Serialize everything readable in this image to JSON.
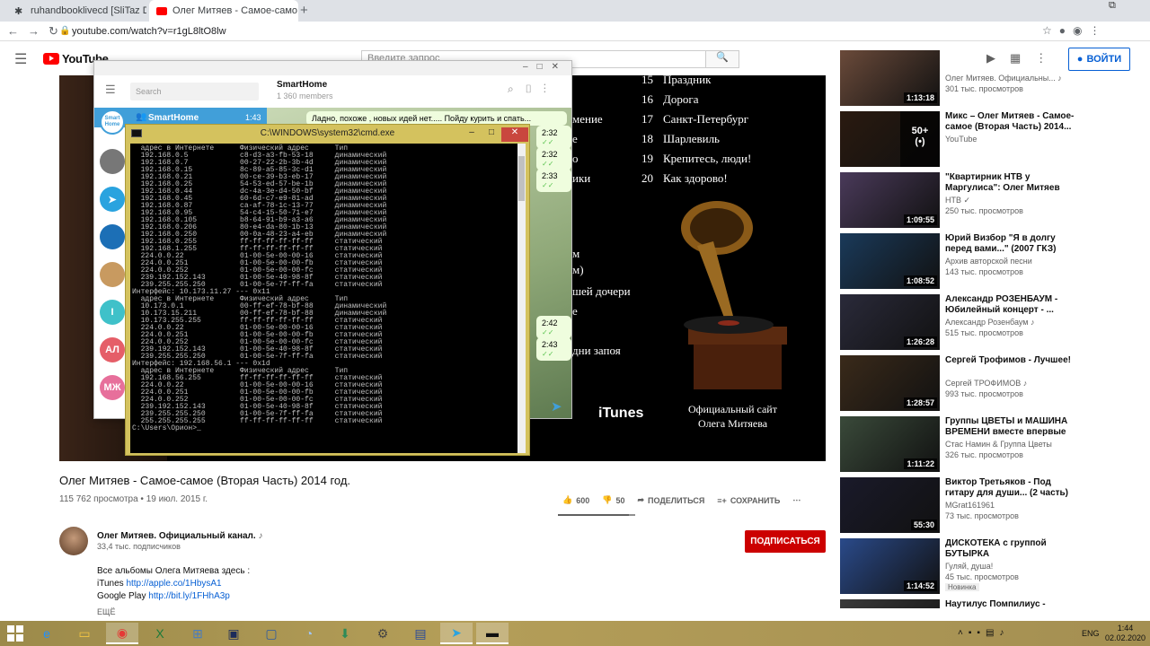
{
  "browser": {
    "tabs": [
      {
        "label": "ruhandbooklivecd [SliTaz Doc]"
      },
      {
        "label": "Олег Митяев - Самое-само"
      }
    ],
    "url": "youtube.com/watch?v=r1gL8ltO8lw"
  },
  "youtube": {
    "search_placeholder": "Введите запрос",
    "signin_label": "ВОЙТИ",
    "video": {
      "tracks": [
        {
          "n": "15",
          "title": "Праздник"
        },
        {
          "n": "16",
          "title": "Дорога"
        },
        {
          "n": "17",
          "title": "Санкт-Петербург"
        },
        {
          "n": "18",
          "title": "Шарлевиль"
        },
        {
          "n": "19",
          "title": "Крепитесь, люди!"
        },
        {
          "n": "20",
          "title": "Как здорово!"
        }
      ],
      "partial_lines": [
        "мение",
        "е",
        "о",
        "ики",
        "м",
        "м)",
        "шей дочери",
        "е",
        "дни запоя"
      ],
      "itunes_label": "iTunes",
      "site_line1": "Официальный сайт",
      "site_line2": "Олега Митяева"
    },
    "title": "Олег Митяев - Самое-самое (Вторая Часть) 2014 год.",
    "stats": "115 762 просмотра • 19 июл. 2015 г.",
    "likes": "600",
    "dislikes": "50",
    "share_label": "ПОДЕЛИТЬСЯ",
    "save_label": "СОХРАНИТЬ",
    "like_ratio": 0.92,
    "channel": {
      "name": "Олег Митяев. Официальный канал.",
      "subs": "33,4 тыс. подписчиков",
      "subscribe_label": "ПОДПИСАТЬСЯ"
    },
    "description": {
      "line1": "Все альбомы Олега Митяева здесь :",
      "itunes_prefix": "iTunes",
      "itunes_link": "http://apple.co/1HbysA1",
      "gplay_prefix": "Google Play",
      "gplay_link": "http://bit.ly/1FHhA3p",
      "more": "ЕЩЁ"
    },
    "recommendations": [
      {
        "title": "",
        "channel": "Олег Митяев. Официальны... ♪",
        "views": "301 тыс. просмотров",
        "duration": "1:13:18"
      },
      {
        "title": "Микс – Олег Митяев - Самое-самое (Вторая Часть) 2014...",
        "channel": "YouTube",
        "views": "",
        "duration": ""
      },
      {
        "title": "\"Квартирник НТВ у Маргулиса\": Олег Митяев",
        "channel": "НТВ ✓",
        "views": "250 тыс. просмотров",
        "duration": "1:09:55"
      },
      {
        "title": "Юрий Визбор \"Я в долгу перед вами...\" (2007 ГКЗ)",
        "channel": "Архив авторской песни",
        "views": "143 тыс. просмотров",
        "duration": "1:08:52"
      },
      {
        "title": "Александр РОЗЕНБАУМ - Юбилейный концерт - ...",
        "channel": "Александр Розенбаум ♪",
        "views": "515 тыс. просмотров",
        "duration": "1:26:28"
      },
      {
        "title": "Сергей Трофимов - Лучшее!",
        "channel": "Сергей ТРОФИМОВ ♪",
        "views": "993 тыс. просмотров",
        "duration": "1:28:57"
      },
      {
        "title": "Группы ЦВЕТЫ и МАШИНА ВРЕМЕНИ вместе впервые з...",
        "channel": "Стас Намин & Группа Цветы",
        "views": "326 тыс. просмотров",
        "duration": "1:11:22"
      },
      {
        "title": "Виктор Третьяков - Под гитару для души... (2 часть)",
        "channel": "MGrat161961",
        "views": "73 тыс. просмотров",
        "duration": "55:30"
      },
      {
        "title": "ДИСКОТЕКА с группой БУТЫРКА",
        "channel": "Гуляй, душа!",
        "views": "45 тыс. просмотров",
        "duration": "1:14:52",
        "badge": "Новинка"
      },
      {
        "title": "Наутилус Помпилиус -",
        "channel": "",
        "views": "",
        "duration": ""
      }
    ],
    "mix_count": "50+"
  },
  "telegram": {
    "search_placeholder": "Search",
    "chat_name": "SmartHome",
    "members": "1 360 members",
    "selected_chat": "SmartHome",
    "selected_time": "1:43",
    "smarthome_badge": "Smart Home",
    "message": "Ладно, похоже , новых идей нет..... Пойду курить и спать...",
    "times": [
      "2:32",
      "2:32",
      "2:33",
      "2:42",
      "2:43"
    ],
    "avatars": [
      "",
      "",
      "",
      "",
      "",
      "I",
      "АЛ",
      "МЖ"
    ]
  },
  "cmd": {
    "title": "C:\\WINDOWS\\system32\\cmd.exe",
    "lines": [
      "  адрес в Интернете      Физический адрес      Тип",
      "  192.168.0.5            c8-d3-a3-fb-53-18     динамический",
      "  192.168.0.7            00-27-22-2b-3b-4d     динамический",
      "  192.168.0.15           8c-89-a5-85-3c-d1     динамический",
      "  192.168.0.21           00-ce-39-b3-eb-17     динамический",
      "  192.168.0.25           54-53-ed-57-be-1b     динамический",
      "  192.168.0.44           dc-4a-3e-d4-50-bf     динамический",
      "  192.168.0.45           60-6d-c7-e9-81-ad     динамический",
      "  192.168.0.87           ca-af-78-1c-13-77     динамический",
      "  192.168.0.95           54-c4-15-50-71-e7     динамический",
      "  192.168.0.105          b8-64-91-b9-a3-a6     динамический",
      "  192.168.0.206          80-e4-da-80-1b-13     динамический",
      "  192.168.0.250          00-0a-48-23-a4-eb     динамический",
      "  192.168.0.255          ff-ff-ff-ff-ff-ff     статический",
      "  192.168.1.255          ff-ff-ff-ff-ff-ff     статический",
      "  224.0.0.22             01-00-5e-00-00-16     статический",
      "  224.0.0.251            01-00-5e-00-00-fb     статический",
      "  224.0.0.252            01-00-5e-00-00-fc     статический",
      "  239.192.152.143        01-00-5e-40-98-8f     статический",
      "  239.255.255.250        01-00-5e-7f-ff-fa     статический",
      "",
      "Интерфейс: 10.173.11.27 --- 0x11",
      "  адрес в Интернете      Физический адрес      Тип",
      "  10.173.0.1             00-ff-ef-78-bf-88     динамический",
      "  10.173.15.211          00-ff-ef-78-bf-88     динамический",
      "  10.173.255.255         ff-ff-ff-ff-ff-ff     статический",
      "  224.0.0.22             01-00-5e-00-00-16     статический",
      "  224.0.0.251            01-00-5e-00-00-fb     статический",
      "  224.0.0.252            01-00-5e-00-00-fc     статический",
      "  239.192.152.143        01-00-5e-40-98-8f     статический",
      "  239.255.255.250        01-00-5e-7f-ff-fa     статический",
      "",
      "Интерфейс: 192.168.56.1 --- 0x1d",
      "  адрес в Интернете      Физический адрес      Тип",
      "  192.168.56.255         ff-ff-ff-ff-ff-ff     статический",
      "  224.0.0.22             01-00-5e-00-00-16     статический",
      "  224.0.0.251            01-00-5e-00-00-fb     статический",
      "  224.0.0.252            01-00-5e-00-00-fc     статический",
      "  239.192.152.143        01-00-5e-40-98-8f     статический",
      "  239.255.255.250        01-00-5e-7f-ff-fa     статический",
      "  255.255.255.255        ff-ff-ff-ff-ff-ff     статический",
      "",
      "C:\\Users\\Орион>_"
    ]
  },
  "taskbar": {
    "lang": "ENG",
    "time": "1:44",
    "date": "02.02.2020"
  },
  "colors": {
    "youtube_red": "#ff0000",
    "subscribe_red": "#cc0000",
    "link_blue": "#065fd4",
    "telegram_blue": "#419fd9",
    "cmd_frame": "#d4c25e"
  }
}
